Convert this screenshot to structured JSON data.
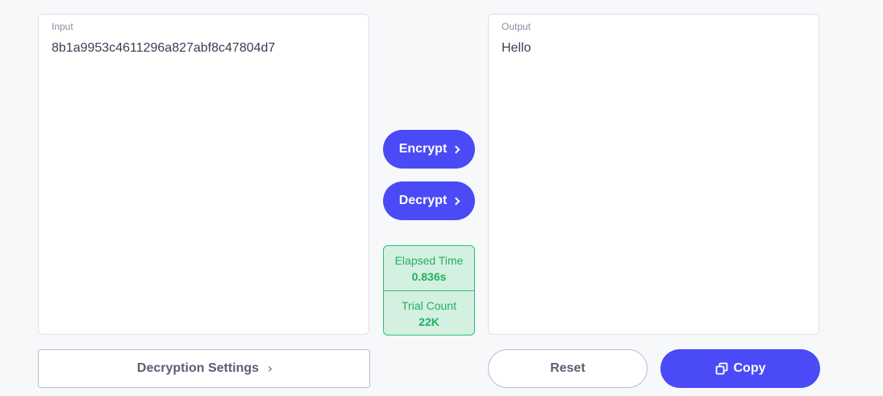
{
  "input": {
    "label": "Input",
    "value": "8b1a9953c4611296a827abf8c47804d7"
  },
  "output": {
    "label": "Output",
    "value": "Hello"
  },
  "actions": {
    "encrypt_label": "Encrypt",
    "decrypt_label": "Decrypt"
  },
  "stats": {
    "elapsed_label": "Elapsed Time",
    "elapsed_value": "0.836s",
    "trial_label": "Trial Count",
    "trial_value": "22K"
  },
  "footer": {
    "settings_label": "Decryption Settings",
    "reset_label": "Reset",
    "copy_label": "Copy"
  },
  "icons": {
    "chevron": "chevron-right-icon",
    "copy": "copy-icon"
  },
  "colors": {
    "primary": "#4a4af6",
    "success": "#22b060",
    "success_bg": "#d3f0e0"
  }
}
